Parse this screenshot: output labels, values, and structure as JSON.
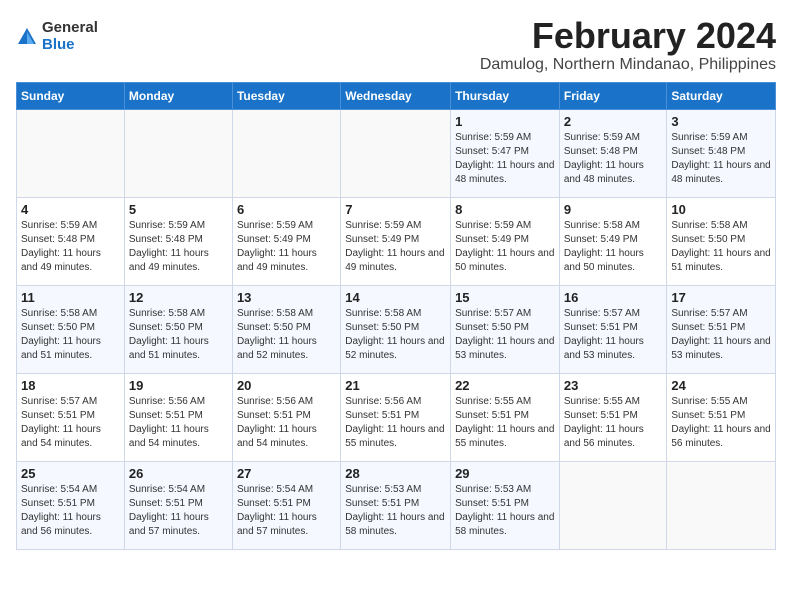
{
  "logo": {
    "general": "General",
    "blue": "Blue"
  },
  "title": {
    "month": "February 2024",
    "location": "Damulog, Northern Mindanao, Philippines"
  },
  "headers": [
    "Sunday",
    "Monday",
    "Tuesday",
    "Wednesday",
    "Thursday",
    "Friday",
    "Saturday"
  ],
  "weeks": [
    [
      {
        "day": "",
        "info": ""
      },
      {
        "day": "",
        "info": ""
      },
      {
        "day": "",
        "info": ""
      },
      {
        "day": "",
        "info": ""
      },
      {
        "day": "1",
        "sunrise": "5:59 AM",
        "sunset": "5:47 PM",
        "daylight": "11 hours and 48 minutes."
      },
      {
        "day": "2",
        "sunrise": "5:59 AM",
        "sunset": "5:48 PM",
        "daylight": "11 hours and 48 minutes."
      },
      {
        "day": "3",
        "sunrise": "5:59 AM",
        "sunset": "5:48 PM",
        "daylight": "11 hours and 48 minutes."
      }
    ],
    [
      {
        "day": "4",
        "sunrise": "5:59 AM",
        "sunset": "5:48 PM",
        "daylight": "11 hours and 49 minutes."
      },
      {
        "day": "5",
        "sunrise": "5:59 AM",
        "sunset": "5:48 PM",
        "daylight": "11 hours and 49 minutes."
      },
      {
        "day": "6",
        "sunrise": "5:59 AM",
        "sunset": "5:49 PM",
        "daylight": "11 hours and 49 minutes."
      },
      {
        "day": "7",
        "sunrise": "5:59 AM",
        "sunset": "5:49 PM",
        "daylight": "11 hours and 49 minutes."
      },
      {
        "day": "8",
        "sunrise": "5:59 AM",
        "sunset": "5:49 PM",
        "daylight": "11 hours and 50 minutes."
      },
      {
        "day": "9",
        "sunrise": "5:58 AM",
        "sunset": "5:49 PM",
        "daylight": "11 hours and 50 minutes."
      },
      {
        "day": "10",
        "sunrise": "5:58 AM",
        "sunset": "5:50 PM",
        "daylight": "11 hours and 51 minutes."
      }
    ],
    [
      {
        "day": "11",
        "sunrise": "5:58 AM",
        "sunset": "5:50 PM",
        "daylight": "11 hours and 51 minutes."
      },
      {
        "day": "12",
        "sunrise": "5:58 AM",
        "sunset": "5:50 PM",
        "daylight": "11 hours and 51 minutes."
      },
      {
        "day": "13",
        "sunrise": "5:58 AM",
        "sunset": "5:50 PM",
        "daylight": "11 hours and 52 minutes."
      },
      {
        "day": "14",
        "sunrise": "5:58 AM",
        "sunset": "5:50 PM",
        "daylight": "11 hours and 52 minutes."
      },
      {
        "day": "15",
        "sunrise": "5:57 AM",
        "sunset": "5:50 PM",
        "daylight": "11 hours and 53 minutes."
      },
      {
        "day": "16",
        "sunrise": "5:57 AM",
        "sunset": "5:51 PM",
        "daylight": "11 hours and 53 minutes."
      },
      {
        "day": "17",
        "sunrise": "5:57 AM",
        "sunset": "5:51 PM",
        "daylight": "11 hours and 53 minutes."
      }
    ],
    [
      {
        "day": "18",
        "sunrise": "5:57 AM",
        "sunset": "5:51 PM",
        "daylight": "11 hours and 54 minutes."
      },
      {
        "day": "19",
        "sunrise": "5:56 AM",
        "sunset": "5:51 PM",
        "daylight": "11 hours and 54 minutes."
      },
      {
        "day": "20",
        "sunrise": "5:56 AM",
        "sunset": "5:51 PM",
        "daylight": "11 hours and 54 minutes."
      },
      {
        "day": "21",
        "sunrise": "5:56 AM",
        "sunset": "5:51 PM",
        "daylight": "11 hours and 55 minutes."
      },
      {
        "day": "22",
        "sunrise": "5:55 AM",
        "sunset": "5:51 PM",
        "daylight": "11 hours and 55 minutes."
      },
      {
        "day": "23",
        "sunrise": "5:55 AM",
        "sunset": "5:51 PM",
        "daylight": "11 hours and 56 minutes."
      },
      {
        "day": "24",
        "sunrise": "5:55 AM",
        "sunset": "5:51 PM",
        "daylight": "11 hours and 56 minutes."
      }
    ],
    [
      {
        "day": "25",
        "sunrise": "5:54 AM",
        "sunset": "5:51 PM",
        "daylight": "11 hours and 56 minutes."
      },
      {
        "day": "26",
        "sunrise": "5:54 AM",
        "sunset": "5:51 PM",
        "daylight": "11 hours and 57 minutes."
      },
      {
        "day": "27",
        "sunrise": "5:54 AM",
        "sunset": "5:51 PM",
        "daylight": "11 hours and 57 minutes."
      },
      {
        "day": "28",
        "sunrise": "5:53 AM",
        "sunset": "5:51 PM",
        "daylight": "11 hours and 58 minutes."
      },
      {
        "day": "29",
        "sunrise": "5:53 AM",
        "sunset": "5:51 PM",
        "daylight": "11 hours and 58 minutes."
      },
      {
        "day": "",
        "info": ""
      },
      {
        "day": "",
        "info": ""
      }
    ]
  ]
}
